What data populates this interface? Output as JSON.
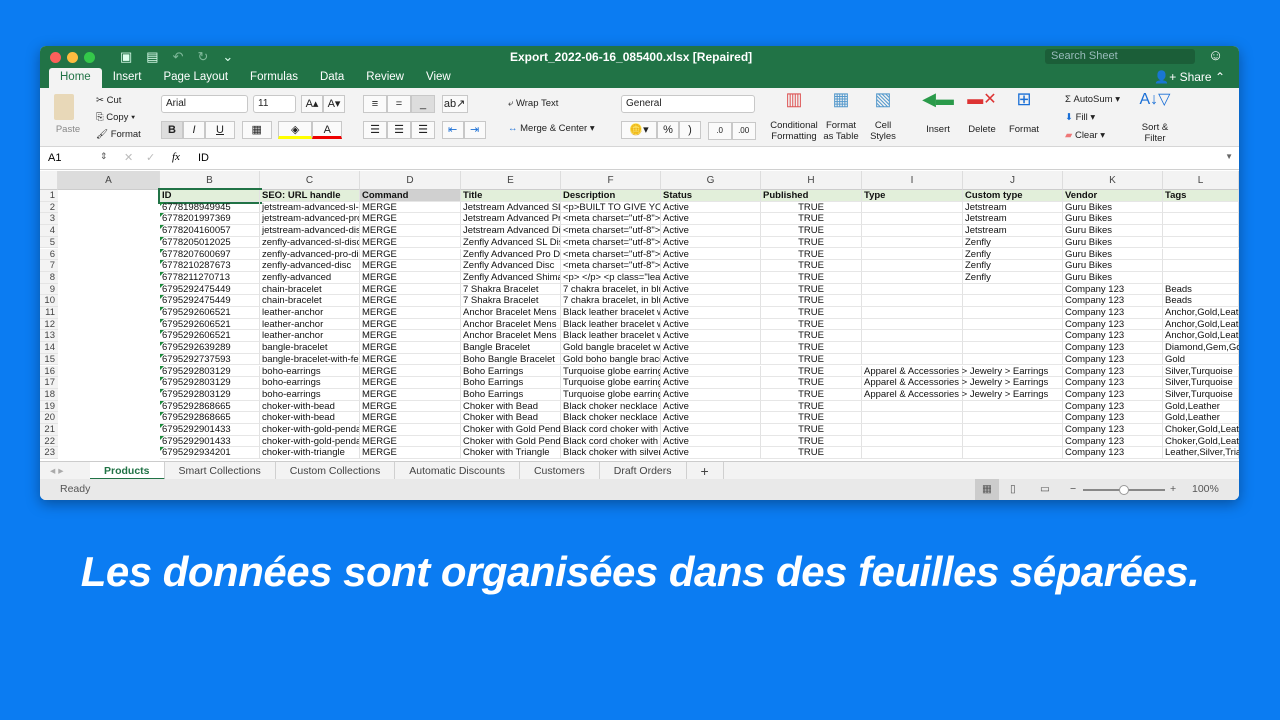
{
  "window": {
    "title": "Export_2022-06-16_085400.xlsx [Repaired]",
    "search_placeholder": "Search Sheet",
    "share": "Share"
  },
  "tabs": [
    "Home",
    "Insert",
    "Page Layout",
    "Formulas",
    "Data",
    "Review",
    "View"
  ],
  "ribbon": {
    "paste": "Paste",
    "cut": "Cut",
    "copy": "Copy",
    "format": "Format",
    "font": "Arial",
    "size": "11",
    "bold": "B",
    "italic": "I",
    "underline": "U",
    "wrap": "Wrap Text",
    "merge": "Merge & Center",
    "number_format": "General",
    "percent": "%",
    "cond": "Conditional Formatting",
    "fmt_table": "Format as Table",
    "cell_styles": "Cell Styles",
    "insert": "Insert",
    "delete": "Delete",
    "format2": "Format",
    "autosum": "AutoSum",
    "fill": "Fill",
    "clear": "Clear",
    "sort": "Sort & Filter"
  },
  "formula": {
    "cell_ref": "A1",
    "content": "ID",
    "fx": "fx"
  },
  "columns": [
    "A",
    "B",
    "C",
    "D",
    "E",
    "F",
    "G",
    "H",
    "I",
    "J",
    "K",
    "L"
  ],
  "rows": [
    [
      "ID",
      "SEO: URL handle",
      "Command",
      "Title",
      "Description",
      "Status",
      "Published",
      "Type",
      "Custom type",
      "Vendor",
      "Tags",
      "Theme template"
    ],
    [
      "6778198949945",
      "jetstream-advanced-sl-d",
      "MERGE",
      "Jetstream Advanced SL",
      "<p>BUILT TO GIVE YO",
      "Active",
      "TRUE",
      "",
      "Jetstream",
      "Guru Bikes",
      "",
      ""
    ],
    [
      "6778201997369",
      "jetstream-advanced-pro",
      "MERGE",
      "Jetstream Advanced Pro",
      "<meta charset=\"utf-8\"> -",
      "Active",
      "TRUE",
      "",
      "Jetstream",
      "Guru Bikes",
      "",
      ""
    ],
    [
      "6778204160057",
      "jetstream-advanced-disc",
      "MERGE",
      "Jetstream Advanced Dis",
      "<meta charset=\"utf-8\"> -",
      "Active",
      "TRUE",
      "",
      "Jetstream",
      "Guru Bikes",
      "",
      ""
    ],
    [
      "6778205012025",
      "zenfly-advanced-sl-disc",
      "MERGE",
      "Zenfly Advanced SL Dis",
      "<meta charset=\"utf-8\"><",
      "Active",
      "TRUE",
      "",
      "Zenfly",
      "Guru Bikes",
      "",
      ""
    ],
    [
      "6778207600697",
      "zenfly-advanced-pro-dis",
      "MERGE",
      "Zenfly Advanced Pro Di",
      "<meta charset=\"utf-8\"><",
      "Active",
      "TRUE",
      "",
      "Zenfly",
      "Guru Bikes",
      "",
      ""
    ],
    [
      "6778210287673",
      "zenfly-advanced-disc",
      "MERGE",
      "Zenfly Advanced Disc",
      "<meta charset=\"utf-8\"><",
      "Active",
      "TRUE",
      "",
      "Zenfly",
      "Guru Bikes",
      "",
      ""
    ],
    [
      "6778211270713",
      "zenfly-advanced",
      "MERGE",
      "Zenfly Advanced Shimai",
      "<p> </p> <p class=\"lead",
      "Active",
      "TRUE",
      "",
      "Zenfly",
      "Guru Bikes",
      "",
      ""
    ],
    [
      "6795292475449",
      "chain-bracelet",
      "MERGE",
      "7 Shakra Bracelet",
      "7 chakra bracelet, in blu",
      "Active",
      "TRUE",
      "",
      "",
      "Company 123",
      "Beads",
      ""
    ],
    [
      "6795292475449",
      "chain-bracelet",
      "MERGE",
      "7 Shakra Bracelet",
      "7 chakra bracelet, in blu",
      "Active",
      "TRUE",
      "",
      "",
      "Company 123",
      "Beads",
      ""
    ],
    [
      "6795292606521",
      "leather-anchor",
      "MERGE",
      "Anchor Bracelet Mens",
      "Black leather bracelet w",
      "Active",
      "TRUE",
      "",
      "",
      "Company 123",
      "Anchor,Gold,Leather,Silver",
      ""
    ],
    [
      "6795292606521",
      "leather-anchor",
      "MERGE",
      "Anchor Bracelet Mens",
      "Black leather bracelet w",
      "Active",
      "TRUE",
      "",
      "",
      "Company 123",
      "Anchor,Gold,Leather,Silver",
      ""
    ],
    [
      "6795292606521",
      "leather-anchor",
      "MERGE",
      "Anchor Bracelet Mens",
      "Black leather bracelet w",
      "Active",
      "TRUE",
      "",
      "",
      "Company 123",
      "Anchor,Gold,Leather,Silver",
      ""
    ],
    [
      "6795292639289",
      "bangle-bracelet",
      "MERGE",
      "Bangle Bracelet",
      "Gold bangle bracelet wit",
      "Active",
      "TRUE",
      "",
      "",
      "Company 123",
      "Diamond,Gem,Gold",
      ""
    ],
    [
      "6795292737593",
      "bangle-bracelet-with-fea",
      "MERGE",
      "Boho Bangle Bracelet",
      "Gold boho bangle brace",
      "Active",
      "TRUE",
      "",
      "",
      "Company 123",
      "Gold",
      ""
    ],
    [
      "6795292803129",
      "boho-earrings",
      "MERGE",
      "Boho Earrings",
      "Turquoise globe earrings",
      "Active",
      "TRUE",
      "Apparel & Accessories > Jewelry > Earrings",
      "",
      "Company 123",
      "Silver,Turquoise",
      ""
    ],
    [
      "6795292803129",
      "boho-earrings",
      "MERGE",
      "Boho Earrings",
      "Turquoise globe earrings",
      "Active",
      "TRUE",
      "Apparel & Accessories > Jewelry > Earrings",
      "",
      "Company 123",
      "Silver,Turquoise",
      ""
    ],
    [
      "6795292803129",
      "boho-earrings",
      "MERGE",
      "Boho Earrings",
      "Turquoise globe earrings",
      "Active",
      "TRUE",
      "Apparel & Accessories > Jewelry > Earrings",
      "",
      "Company 123",
      "Silver,Turquoise",
      ""
    ],
    [
      "6795292868665",
      "choker-with-bead",
      "MERGE",
      "Choker with Bead",
      "Black choker necklace w",
      "Active",
      "TRUE",
      "",
      "",
      "Company 123",
      "Gold,Leather",
      ""
    ],
    [
      "6795292868665",
      "choker-with-bead",
      "MERGE",
      "Choker with Bead",
      "Black choker necklace w",
      "Active",
      "TRUE",
      "",
      "",
      "Company 123",
      "Gold,Leather",
      ""
    ],
    [
      "6795292901433",
      "choker-with-gold-pendant",
      "MERGE",
      "Choker with Gold Penda",
      "Black cord choker with g",
      "Active",
      "TRUE",
      "",
      "",
      "Company 123",
      "Choker,Gold,Leather,Pendant",
      ""
    ],
    [
      "6795292901433",
      "choker-with-gold-pendant",
      "MERGE",
      "Choker with Gold Penda",
      "Black cord choker with g",
      "Active",
      "TRUE",
      "",
      "",
      "Company 123",
      "Choker,Gold,Leather,Pendant",
      ""
    ],
    [
      "6795292934201",
      "choker-with-triangle",
      "MERGE",
      "Choker with Triangle",
      "Black choker with silver",
      "Active",
      "TRUE",
      "",
      "",
      "Company 123",
      "Leather,Silver,Triangle",
      ""
    ]
  ],
  "sheets": [
    "Products",
    "Smart Collections",
    "Custom Collections",
    "Automatic Discounts",
    "Customers",
    "Draft Orders"
  ],
  "add_sheet": "+",
  "status": {
    "text": "Ready",
    "zoom": "100%",
    "zoom_level": 0.5
  },
  "caption": "Les données sont organisées dans des feuilles séparées.",
  "colors": {
    "excel_green": "#217346",
    "background": "#0b7cf2",
    "header_fill": "#e2efda"
  }
}
